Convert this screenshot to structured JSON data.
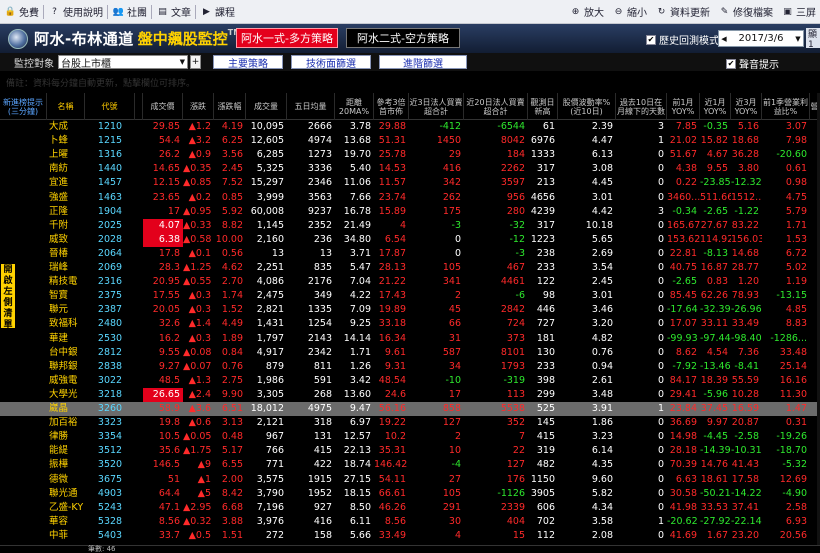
{
  "menubar": {
    "left": [
      {
        "label": "免費",
        "icon": "lock-icon",
        "glyph": "🔒"
      },
      {
        "label": "使用說明",
        "icon": "help-icon",
        "glyph": "?"
      },
      {
        "label": "社團",
        "icon": "people-icon",
        "glyph": "👥"
      },
      {
        "label": "文章",
        "icon": "article-icon",
        "glyph": "▤"
      },
      {
        "label": "課程",
        "icon": "video-icon",
        "glyph": "▶"
      }
    ],
    "right": [
      {
        "label": "放大",
        "icon": "zoom-in-icon",
        "glyph": "⊕"
      },
      {
        "label": "縮小",
        "icon": "zoom-out-icon",
        "glyph": "⊖"
      },
      {
        "label": "資料更新",
        "icon": "refresh-icon",
        "glyph": "↻"
      },
      {
        "label": "修復檔案",
        "icon": "repair-icon",
        "glyph": "✎"
      },
      {
        "label": "三屏",
        "icon": "screens-icon",
        "glyph": "▣"
      }
    ]
  },
  "titlebar": {
    "title": "阿水-布林通道",
    "subtitle": "盤中飆股監控",
    "tm": "TM",
    "tab_active": "阿水一式-多方策略",
    "tab_other": "阿水二式-空方策略",
    "history_label": "歷史回測模式",
    "date": "2017/3/6",
    "right_tab": "顯1"
  },
  "controls": {
    "watch_label": "監控對象",
    "market_select": "台股上市櫃",
    "plus": "+",
    "btn_main": "主要策略",
    "btn_tech": "技術面篩選",
    "btn_adv": "進階篩選",
    "sound_label": "聲音提示"
  },
  "notice": "備註：資料每分鐘自動更新，點擊欄位可排序。",
  "sidebar_label": "開啟左側清單",
  "columns": [
    "新進榜提示(三分鐘)",
    "名稱",
    "代號",
    "",
    "成交價",
    "漲跌",
    "漲跌幅",
    "成交量",
    "五日均量",
    "距離20MA%",
    "參考3倍首市佈",
    "近3日法人買賣超合計",
    "近20日法人買賣超合計",
    "觀測日新高",
    "股價波動率%(近10日)",
    "過去10日在月線下的天數",
    "前1月YOY%",
    "近1月YOY%",
    "近3月YOY%",
    "前1季營業利益比%",
    "營"
  ],
  "colors": {
    "red": "#ff2a2a",
    "green": "#2ee82e",
    "white": "#ffffff",
    "yellow": "#ffd200",
    "gold": "#ffcc00",
    "sky": "#5aa5ff",
    "cyan": "#5ad7ff"
  },
  "rows": [
    [
      "大成",
      "1210",
      "29.85",
      "▲1.2",
      "4.19",
      "10,095",
      "2666",
      "3.78",
      "29.88",
      "-412",
      "-6544",
      "61",
      "2.39",
      "3",
      "7.85",
      "-0.35",
      "5.16",
      "3.07"
    ],
    [
      "卜蜂",
      "1215",
      "54.4",
      "▲3.2",
      "6.25",
      "12,605",
      "4974",
      "13.68",
      "51.31",
      "1450",
      "8042",
      "6976",
      "4.47",
      "1",
      "21.02",
      "15.82",
      "18.68",
      "7.98"
    ],
    [
      "上曜",
      "1316",
      "26.2",
      "▲0.9",
      "3.56",
      "6,285",
      "1273",
      "19.70",
      "25.78",
      "29",
      "184",
      "1333",
      "6.13",
      "0",
      "51.67",
      "4.67",
      "36.28",
      "-20.60"
    ],
    [
      "南紡",
      "1440",
      "14.65",
      "▲0.35",
      "2.45",
      "5,325",
      "3336",
      "5.40",
      "14.53",
      "416",
      "2262",
      "317",
      "3.08",
      "0",
      "4.38",
      "9.55",
      "3.80",
      "0.61"
    ],
    [
      "宜進",
      "1457",
      "12.15",
      "▲0.85",
      "7.52",
      "15,297",
      "2346",
      "11.06",
      "11.57",
      "342",
      "3597",
      "213",
      "4.45",
      "0",
      "0.22",
      "-23.85",
      "-12.32",
      "0.98"
    ],
    [
      "強盛",
      "1463",
      "23.65",
      "▲0.2",
      "0.85",
      "3,999",
      "3563",
      "7.66",
      "23.74",
      "262",
      "956",
      "4656",
      "3.01",
      "0",
      "3460...",
      "511.66",
      "1512...",
      "4.75"
    ],
    [
      "正隆",
      "1904",
      "17",
      "▲0.95",
      "5.92",
      "60,008",
      "9237",
      "16.78",
      "15.89",
      "175",
      "280",
      "4239",
      "4.42",
      "3",
      "-0.34",
      "-2.65",
      "-1.22",
      "5.79"
    ],
    [
      "千附",
      "2025",
      "4.07",
      "▲0.33",
      "8.82",
      "1,145",
      "2352",
      "21.49",
      "4",
      "-3",
      "-32",
      "317",
      "10.18",
      "0",
      "165.67",
      "27.67",
      "83.22",
      "1.71"
    ],
    [
      "威致",
      "2028",
      "6.38",
      "▲0.58",
      "10.00",
      "2,160",
      "236",
      "34.80",
      "6.54",
      "0",
      "-12",
      "1223",
      "5.65",
      "0",
      "153.62",
      "114.92",
      "156.03",
      "1.53"
    ],
    [
      "晉椿",
      "2064",
      "17.8",
      "▲0.1",
      "0.56",
      "13",
      "13",
      "3.71",
      "17.87",
      "0",
      "-3",
      "238",
      "2.69",
      "0",
      "22.81",
      "-8.13",
      "14.68",
      "6.72"
    ],
    [
      "瑞峰",
      "2069",
      "28.3",
      "▲1.25",
      "4.62",
      "2,251",
      "835",
      "5.47",
      "28.13",
      "105",
      "467",
      "233",
      "3.54",
      "0",
      "40.75",
      "16.87",
      "28.77",
      "5.02"
    ],
    [
      "精技電",
      "2316",
      "20.95",
      "▲0.55",
      "2.70",
      "4,086",
      "2176",
      "7.04",
      "21.22",
      "341",
      "4461",
      "122",
      "2.45",
      "0",
      "-2.65",
      "0.83",
      "1.20",
      "1.19"
    ],
    [
      "智寶",
      "2375",
      "17.55",
      "▲0.3",
      "1.74",
      "2,475",
      "349",
      "4.22",
      "17.43",
      "2",
      "-6",
      "98",
      "3.01",
      "0",
      "85.45",
      "62.26",
      "78.93",
      "-13.15"
    ],
    [
      "聯元",
      "2387",
      "20.05",
      "▲0.3",
      "1.52",
      "2,821",
      "1335",
      "7.09",
      "19.89",
      "45",
      "2842",
      "446",
      "3.46",
      "0",
      "-17.64",
      "-32.39",
      "-26.96",
      "4.85"
    ],
    [
      "致福科",
      "2480",
      "32.6",
      "▲1.4",
      "4.49",
      "1,431",
      "1254",
      "9.25",
      "33.18",
      "66",
      "724",
      "727",
      "3.20",
      "0",
      "17.07",
      "33.11",
      "33.49",
      "8.83"
    ],
    [
      "華建",
      "2530",
      "16.2",
      "▲0.3",
      "1.89",
      "1,797",
      "2143",
      "14.14",
      "16.34",
      "31",
      "373",
      "181",
      "4.82",
      "0",
      "-99.93",
      "-97.44",
      "-98.40",
      "-1286..."
    ],
    [
      "台中銀",
      "2812",
      "9.55",
      "▲0.08",
      "0.84",
      "4,917",
      "2342",
      "1.71",
      "9.61",
      "587",
      "8101",
      "130",
      "0.76",
      "0",
      "8.62",
      "4.54",
      "7.36",
      "33.48"
    ],
    [
      "聯邦銀",
      "2838",
      "9.27",
      "▲0.07",
      "0.76",
      "879",
      "811",
      "1.26",
      "9.31",
      "34",
      "1793",
      "233",
      "0.94",
      "0",
      "-7.92",
      "-13.46",
      "-8.41",
      "25.14"
    ],
    [
      "威強電",
      "3022",
      "48.5",
      "▲1.3",
      "2.75",
      "1,986",
      "591",
      "3.42",
      "48.54",
      "-10",
      "-319",
      "398",
      "2.61",
      "0",
      "84.17",
      "18.39",
      "55.59",
      "16.16"
    ],
    [
      "大學光",
      "3218",
      "26.65",
      "▲2.4",
      "9.90",
      "3,305",
      "268",
      "13.60",
      "24.6",
      "17",
      "113",
      "299",
      "3.48",
      "0",
      "29.41",
      "-5.96",
      "10.28",
      "11.30"
    ],
    [
      "崴晶",
      "3260",
      "58.9",
      "▲3.6",
      "6.51",
      "18,012",
      "4975",
      "9.47",
      "56.16",
      "858",
      "5538",
      "525",
      "3.91",
      "1",
      "23.84",
      "37.45",
      "16.59",
      "1.47"
    ],
    [
      "加百裕",
      "3323",
      "19.8",
      "▲0.6",
      "3.13",
      "2,121",
      "318",
      "6.97",
      "19.22",
      "127",
      "352",
      "145",
      "1.86",
      "0",
      "36.69",
      "9.97",
      "20.87",
      "0.31"
    ],
    [
      "律勝",
      "3354",
      "10.5",
      "▲0.05",
      "0.48",
      "967",
      "131",
      "12.57",
      "10.2",
      "2",
      "7",
      "415",
      "3.23",
      "0",
      "14.98",
      "-4.45",
      "-2.58",
      "-19.26"
    ],
    [
      "能緹",
      "3512",
      "35.6",
      "▲1.75",
      "5.17",
      "766",
      "415",
      "22.13",
      "35.31",
      "10",
      "22",
      "319",
      "6.14",
      "0",
      "28.18",
      "-14.39",
      "-10.31",
      "-18.70"
    ],
    [
      "振樺",
      "3520",
      "146.5",
      "▲9",
      "6.55",
      "771",
      "422",
      "18.74",
      "146.42",
      "-4",
      "127",
      "482",
      "4.35",
      "0",
      "70.39",
      "14.76",
      "41.43",
      "-5.32"
    ],
    [
      "德微",
      "3675",
      "51",
      "▲1",
      "2.00",
      "3,575",
      "1915",
      "27.15",
      "54.11",
      "27",
      "176",
      "1150",
      "9.60",
      "0",
      "6.63",
      "18.61",
      "17.58",
      "12.69"
    ],
    [
      "聯光通",
      "4903",
      "64.4",
      "▲5",
      "8.42",
      "3,790",
      "1952",
      "18.15",
      "66.61",
      "105",
      "-1126",
      "3905",
      "5.82",
      "0",
      "30.58",
      "-50.21",
      "-14.22",
      "-4.90"
    ],
    [
      "乙盛-KY",
      "5243",
      "47.1",
      "▲2.95",
      "6.68",
      "7,196",
      "927",
      "8.50",
      "46.26",
      "291",
      "2339",
      "606",
      "4.34",
      "0",
      "41.98",
      "33.53",
      "37.41",
      "2.58"
    ],
    [
      "華容",
      "5328",
      "8.56",
      "▲0.32",
      "3.88",
      "3,976",
      "416",
      "6.11",
      "8.56",
      "30",
      "404",
      "702",
      "3.58",
      "1",
      "-20.62",
      "-27.92",
      "-22.14",
      "6.93"
    ],
    [
      "中菲",
      "5403",
      "33.7",
      "▲0.5",
      "1.51",
      "272",
      "158",
      "5.66",
      "33.49",
      "4",
      "15",
      "112",
      "2.08",
      "0",
      "41.69",
      "1.67",
      "23.20",
      "20.56"
    ]
  ],
  "footer": "筆數: 46"
}
